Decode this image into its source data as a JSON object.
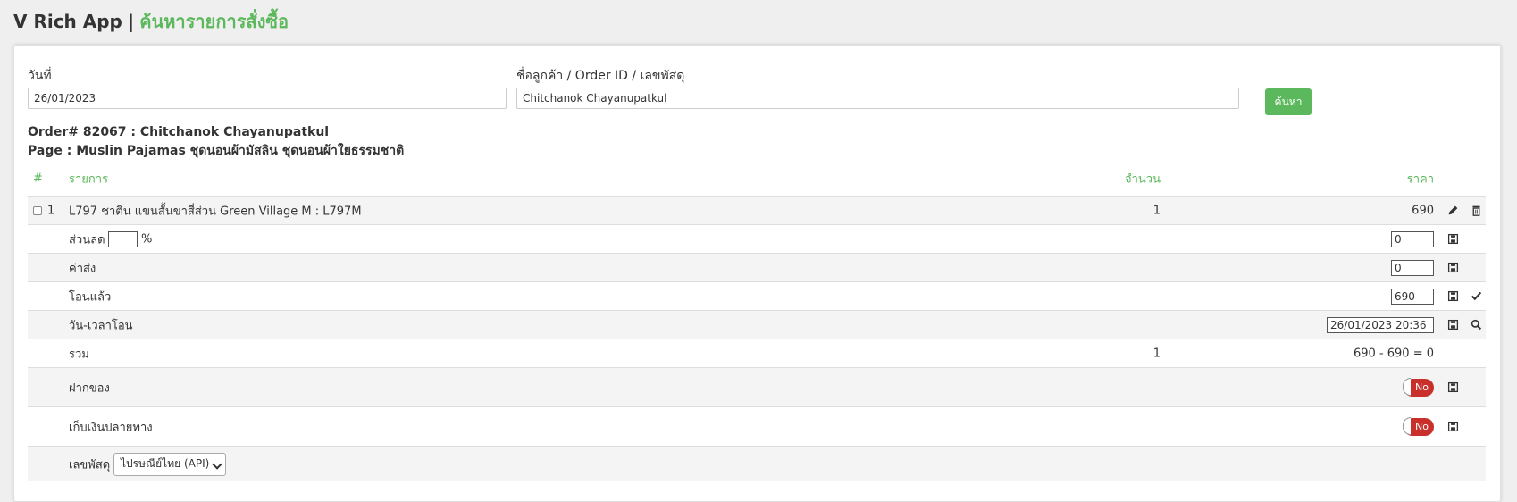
{
  "header": {
    "app_name": "V Rich App",
    "separator": "|",
    "title": "ค้นหารายการสั่งซื้อ"
  },
  "search": {
    "date_label": "วันที่",
    "date_value": "26/01/2023",
    "customer_label": "ชื่อลูกค้า / Order ID / เลขพัสดุ",
    "customer_value": "Chitchanok Chayanupatkul",
    "button_label": "ค้นหา"
  },
  "order": {
    "order_line": "Order# 82067 : Chitchanok Chayanupatkul",
    "page_line": "Page : Muslin Pajamas ชุดนอนผ้ามัสลิน ชุดนอนผ้าใยธรรมชาติ"
  },
  "table": {
    "headers": {
      "num": "#",
      "item": "รายการ",
      "qty": "จำนวน",
      "price": "ราคา"
    },
    "items": [
      {
        "num": "1",
        "name": "L797 ชาติน แขนสั้นขาสี่ส่วน Green Village M : L797M",
        "qty": "1",
        "price": "690"
      }
    ],
    "discount": {
      "label": "ส่วนลด",
      "percent_value": "",
      "percent_sign": "%",
      "value": "0"
    },
    "shipping": {
      "label": "ค่าส่ง",
      "value": "0"
    },
    "transferred": {
      "label": "โอนแล้ว",
      "value": "690"
    },
    "transfer_datetime": {
      "label": "วัน-เวลาโอน",
      "value": "26/01/2023 20:36"
    },
    "total": {
      "label": "รวม",
      "qty": "1",
      "summary": "690 - 690 = 0"
    },
    "deposit": {
      "label": "ฝากของ",
      "toggle": "No"
    },
    "cod": {
      "label": "เก็บเงินปลายทาง",
      "toggle": "No"
    },
    "tracking": {
      "label": "เลขพัสดุ",
      "carrier": "ไปรษณีย์ไทย (API)"
    }
  },
  "colors": {
    "accent": "#5cb85c",
    "danger": "#c9302c"
  }
}
